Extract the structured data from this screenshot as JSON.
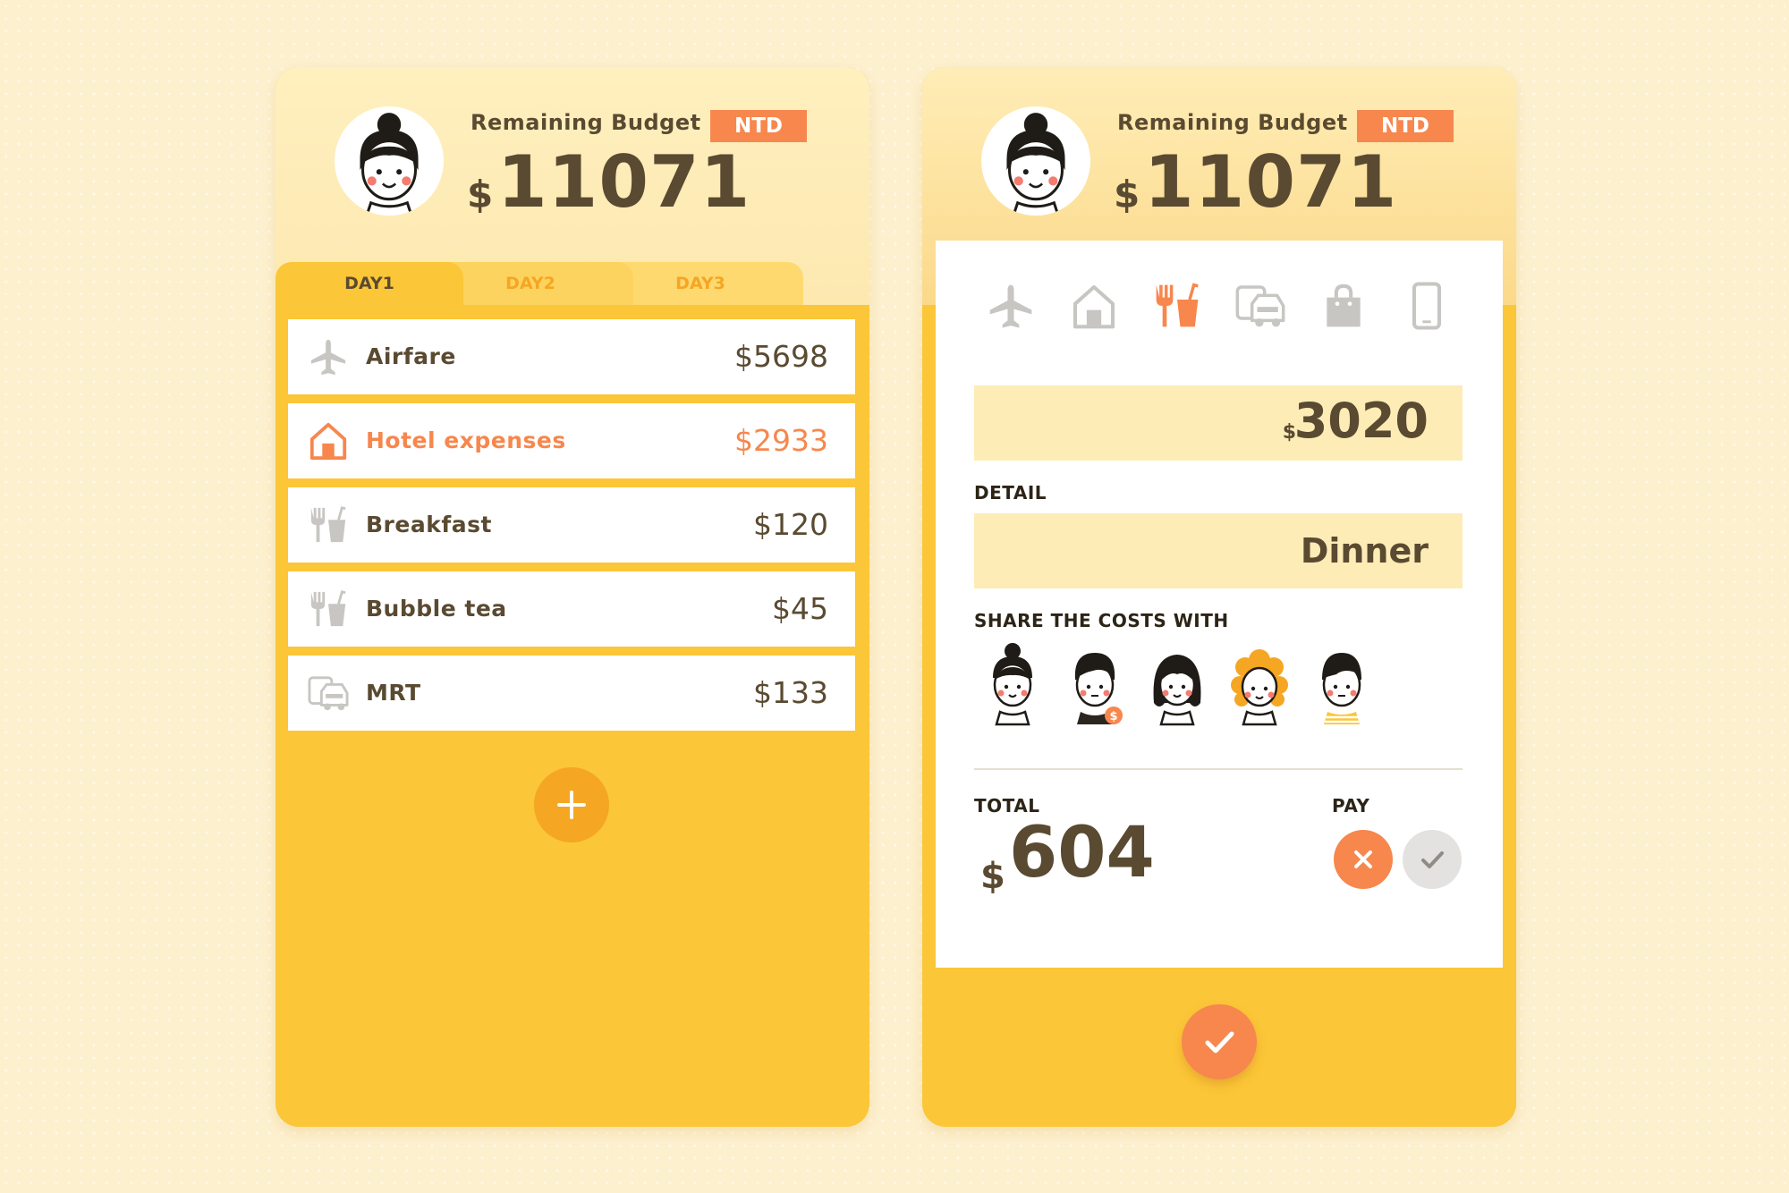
{
  "header": {
    "budget_label": "Remaining Budget",
    "currency_badge": "NTD",
    "currency_symbol": "$",
    "remaining_amount": "11071"
  },
  "tabs": [
    "DAY1",
    "DAY2",
    "DAY3"
  ],
  "active_tab": "DAY1",
  "expenses": [
    {
      "icon": "airplane-icon",
      "label": "Airfare",
      "amount": "$5698",
      "highlighted": false
    },
    {
      "icon": "hotel-icon",
      "label": "Hotel expenses",
      "amount": "$2933",
      "highlighted": true
    },
    {
      "icon": "food-drink-icon",
      "label": "Breakfast",
      "amount": "$120",
      "highlighted": false
    },
    {
      "icon": "food-drink-icon",
      "label": "Bubble tea",
      "amount": "$45",
      "highlighted": false
    },
    {
      "icon": "transport-icon",
      "label": "MRT",
      "amount": "$133",
      "highlighted": false
    }
  ],
  "add_button_icon": "plus-icon",
  "editor": {
    "categories": [
      "airplane-icon",
      "hotel-icon",
      "food-drink-icon",
      "transport-icon",
      "shopping-bag-icon",
      "phone-icon"
    ],
    "selected_category": "food-drink-icon",
    "amount_currency": "$",
    "amount": "3020",
    "detail_label": "DETAIL",
    "detail_value": "Dinner",
    "share_label": "SHARE THE COSTS WITH",
    "people": [
      "person-bun",
      "person-payer",
      "person-long-hair",
      "person-curly-hair",
      "person-short-hair"
    ],
    "payer_badge": "$",
    "total_label": "TOTAL",
    "total_currency": "$",
    "total_value": "604",
    "pay_label": "PAY"
  },
  "colors": {
    "background": "#fdf0cf",
    "panel_yellow": "#fbc637",
    "accent_orange": "#f7874d",
    "text_brown": "#5a4a31",
    "input_fill": "#fdecb6"
  }
}
